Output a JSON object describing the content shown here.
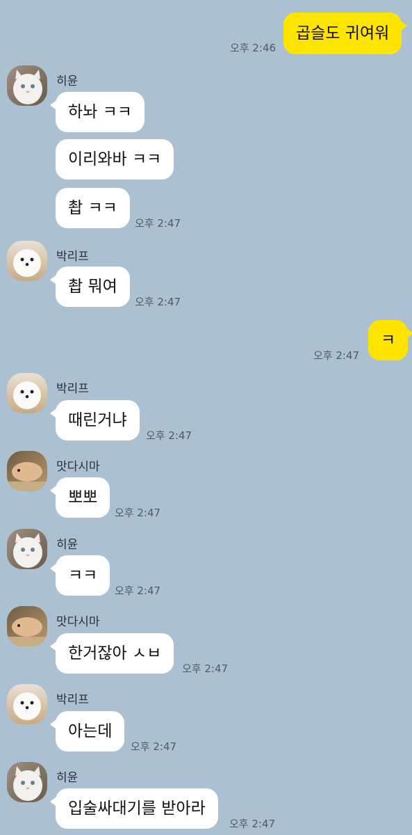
{
  "colors": {
    "background": "#abc1d1",
    "my_bubble": "#fee500",
    "their_bubble": "#ffffff"
  },
  "messages": {
    "m1": {
      "text": "곱슬도 귀여워",
      "time": "오후 2:46"
    },
    "m2": {
      "sender": "히윤",
      "text": "하놔 ㅋㅋ"
    },
    "m3": {
      "text": "이리와바 ㅋㅋ"
    },
    "m4": {
      "text": "촵 ㅋㅋ",
      "time": "오후 2:47"
    },
    "m5": {
      "sender": "박리프",
      "text": "촵 뭐여",
      "time": "오후 2:47"
    },
    "m6": {
      "text": "ㅋ",
      "time": "오후 2:47"
    },
    "m7": {
      "sender": "박리프",
      "text": "때린거냐",
      "time": "오후 2:47"
    },
    "m8": {
      "sender": "맛다시마",
      "text": "뽀뽀",
      "time": "오후 2:47"
    },
    "m9": {
      "sender": "히윤",
      "text": "ㅋㅋ",
      "time": "오후 2:47"
    },
    "m10": {
      "sender": "맛다시마",
      "text": "한거잖아 ㅅㅂ",
      "time": "오후 2:47"
    },
    "m11": {
      "sender": "박리프",
      "text": "아는데",
      "time": "오후 2:47"
    },
    "m12": {
      "sender": "히윤",
      "text": "입술싸대기를 받아라",
      "time": "오후 2:47"
    }
  }
}
